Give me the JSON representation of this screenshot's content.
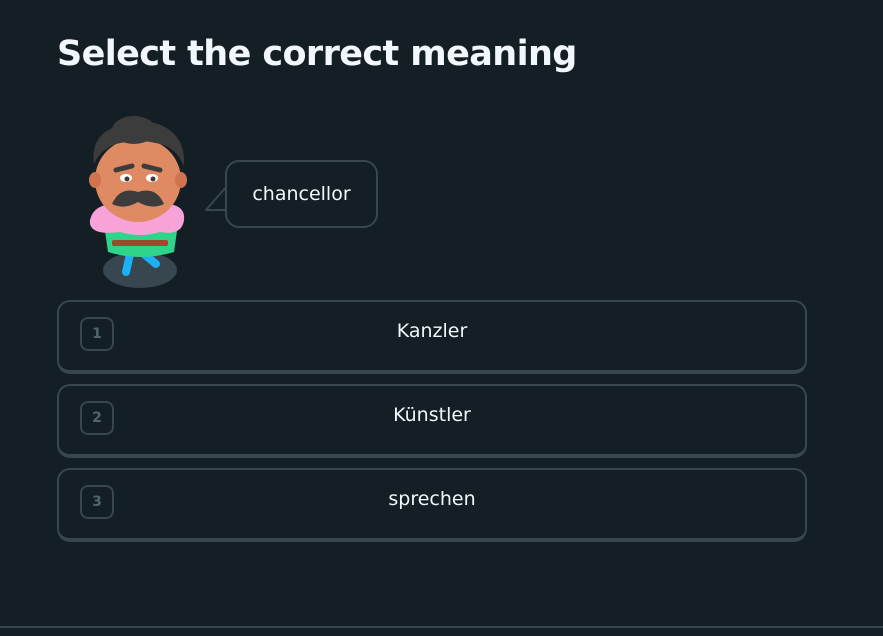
{
  "prompt": {
    "title": "Select the correct meaning"
  },
  "speech": {
    "character_icon": "character-avatar-icon",
    "word": "chancellor"
  },
  "choices": [
    {
      "key": "1",
      "label": "Kanzler"
    },
    {
      "key": "2",
      "label": "Künstler"
    },
    {
      "key": "3",
      "label": "sprechen"
    }
  ],
  "colors": {
    "background": "#131f24",
    "border": "#37464f",
    "text": "#f1f7fb",
    "key_text": "#52656d"
  }
}
